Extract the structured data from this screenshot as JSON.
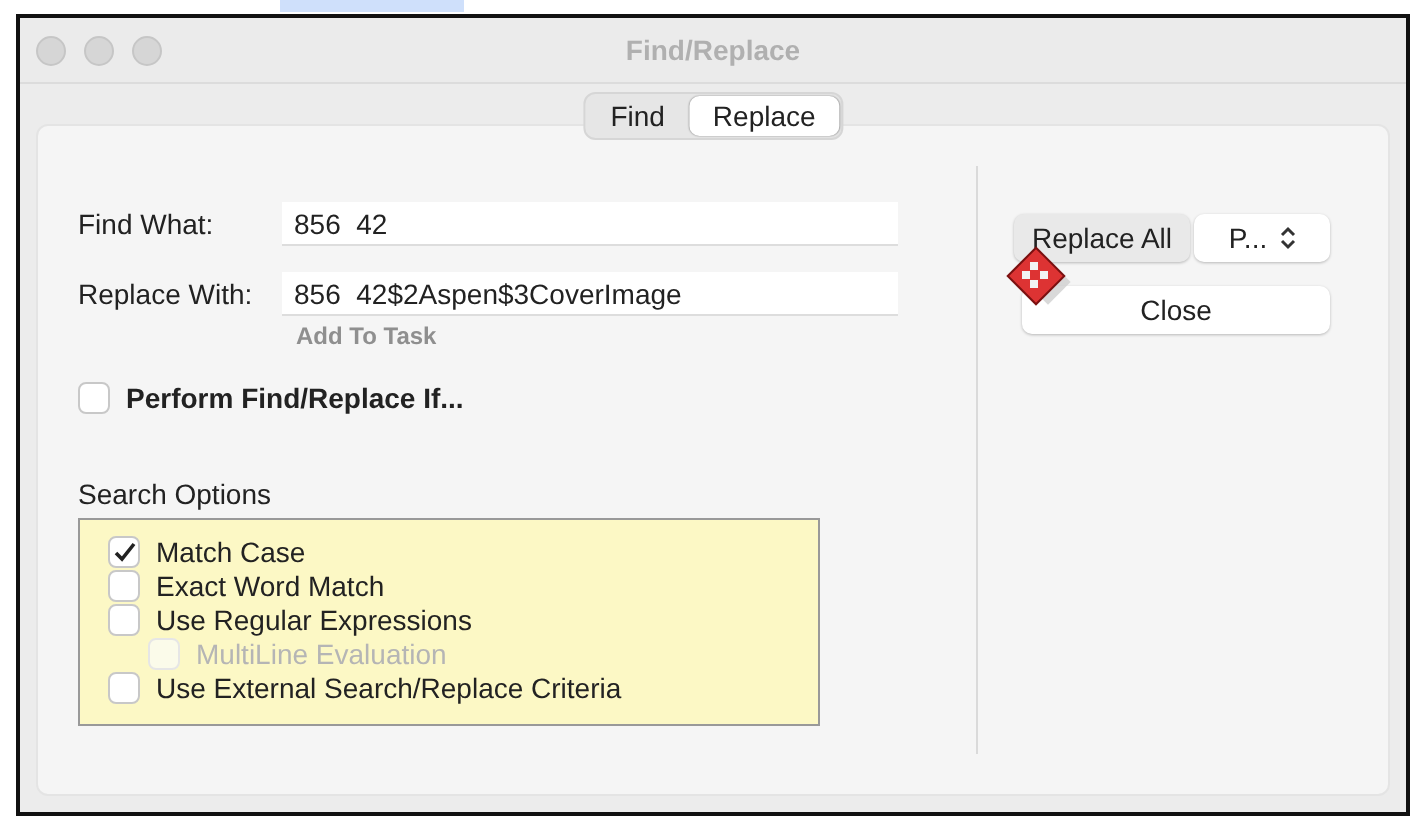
{
  "window": {
    "title": "Find/Replace"
  },
  "tabs": [
    {
      "label": "Find",
      "selected": false
    },
    {
      "label": "Replace",
      "selected": true
    }
  ],
  "fields": [
    {
      "label": "Find What:",
      "value": "856  42"
    },
    {
      "label": "Replace With:",
      "value": "856  42$2Aspen$3CoverImage"
    }
  ],
  "add_to_task": "Add To Task",
  "perform_if": {
    "label": "Perform Find/Replace If...",
    "checked": false
  },
  "search_options": {
    "title": "Search Options",
    "options": [
      {
        "label": "Match Case",
        "checked": true,
        "disabled": false
      },
      {
        "label": "Exact Word Match",
        "checked": false,
        "disabled": false
      },
      {
        "label": "Use Regular Expressions",
        "checked": false,
        "disabled": false,
        "children": [
          {
            "label": "MultiLine Evaluation",
            "checked": false,
            "disabled": true
          }
        ]
      },
      {
        "label": "Use External Search/Replace Criteria",
        "checked": false,
        "disabled": false
      }
    ]
  },
  "buttons": {
    "replace_all": "Replace All",
    "popup": "P...",
    "close": "Close"
  }
}
